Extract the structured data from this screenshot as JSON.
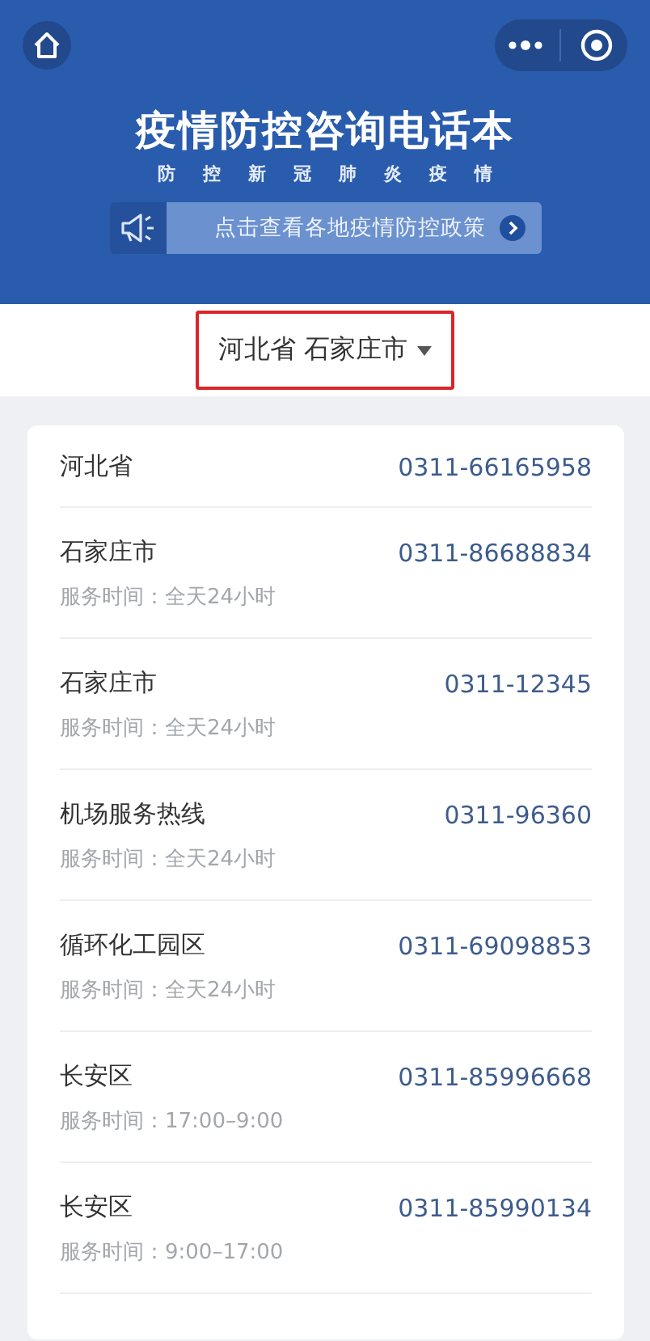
{
  "header": {
    "title": "疫情防控咨询电话本",
    "subtitle": [
      "防",
      "控",
      "新",
      "冠",
      "肺",
      "炎",
      "疫",
      "情"
    ],
    "banner": "点击查看各地疫情防控政策"
  },
  "location": {
    "province": "河北省",
    "city": "石家庄市",
    "highlighted": true
  },
  "contacts": [
    {
      "name": "河北省",
      "phone": "0311-66165958"
    },
    {
      "name": "石家庄市",
      "phone": "0311-86688834",
      "hours": "服务时间：全天24小时"
    },
    {
      "name": "石家庄市",
      "phone": "0311-12345",
      "hours": "服务时间：全天24小时"
    },
    {
      "name": "机场服务热线",
      "phone": "0311-96360",
      "hours": "服务时间：全天24小时"
    },
    {
      "name": "循环化工园区",
      "phone": "0311-69098853",
      "hours": "服务时间：全天24小时"
    },
    {
      "name": "长安区",
      "phone": "0311-85996668",
      "hours": "服务时间：17:00–9:00"
    },
    {
      "name": "长安区",
      "phone": "0311-85990134",
      "hours": "服务时间：9:00–17:00"
    }
  ]
}
